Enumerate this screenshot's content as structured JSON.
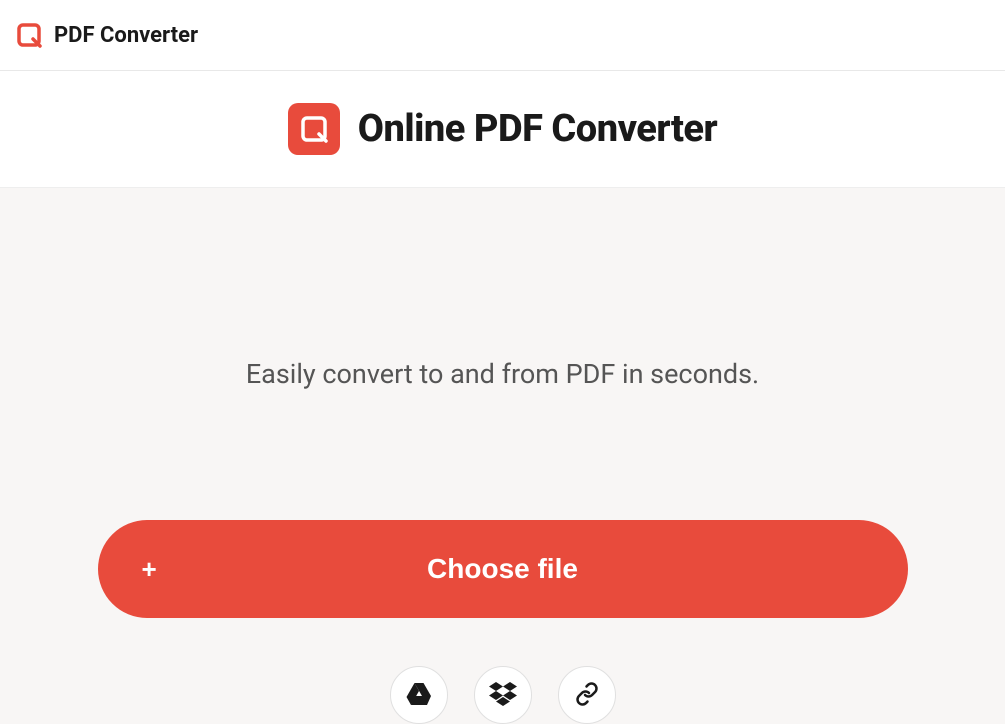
{
  "top_bar": {
    "title": "PDF Converter"
  },
  "hero": {
    "title": "Online PDF Converter"
  },
  "main": {
    "tagline": "Easily convert to and from PDF in seconds.",
    "choose_button_label": "Choose file"
  },
  "sources": {
    "google_drive": "google-drive-icon",
    "dropbox": "dropbox-icon",
    "link": "link-icon"
  },
  "colors": {
    "accent": "#e84b3c",
    "text_primary": "#1a1a1a",
    "text_secondary": "#555555",
    "main_bg": "#f8f6f5"
  }
}
